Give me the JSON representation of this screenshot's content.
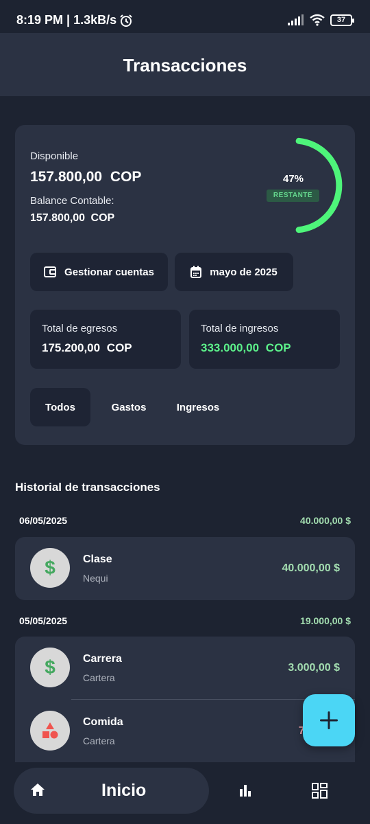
{
  "status_bar": {
    "time": "8:19 PM | 1.3kB/s",
    "battery": "37"
  },
  "app_bar": {
    "title": "Transacciones"
  },
  "summary": {
    "available_label": "Disponible",
    "available_value": "157.800,00 COP",
    "balance_label": "Balance Contable:",
    "balance_value": "157.800,00 COP",
    "progress_percent_text": "47%",
    "progress_fraction": 0.47,
    "progress_badge": "RESTANTE",
    "manage_accounts_label": "Gestionar cuentas",
    "month_label": "mayo de 2025",
    "expenses_label": "Total de egresos",
    "expenses_value": "175.200,00 COP",
    "income_label": "Total de ingresos",
    "income_value": "333.000,00 COP"
  },
  "filters": [
    "Todos",
    "Gastos",
    "Ingresos"
  ],
  "history": {
    "title": "Historial de transacciones",
    "groups": [
      {
        "date": "06/05/2025",
        "total": "40.000,00 $",
        "items": [
          {
            "name": "Clase",
            "account": "Nequi",
            "amount": "40.000,00 $",
            "icon": "dollar-icon",
            "type": "income"
          }
        ]
      },
      {
        "date": "05/05/2025",
        "total": "19.000,00 $",
        "items": [
          {
            "name": "Carrera",
            "account": "Cartera",
            "amount": "3.000,00 $",
            "icon": "dollar-icon",
            "type": "income"
          },
          {
            "name": "Comida",
            "account": "Cartera",
            "amount": "7.0",
            "icon": "shapes-icon",
            "type": "expense"
          }
        ]
      }
    ]
  },
  "fab": {
    "icon": "plus-icon"
  },
  "bottom_nav": {
    "home_label": "Inicio",
    "items": [
      "home-icon",
      "chart-icon",
      "grid-icon"
    ]
  },
  "colors": {
    "accent": "#4bd6f5",
    "positive": "#5cf08a",
    "ring": "#4ef57a",
    "background": "#1d2331",
    "card": "#2b3243"
  }
}
